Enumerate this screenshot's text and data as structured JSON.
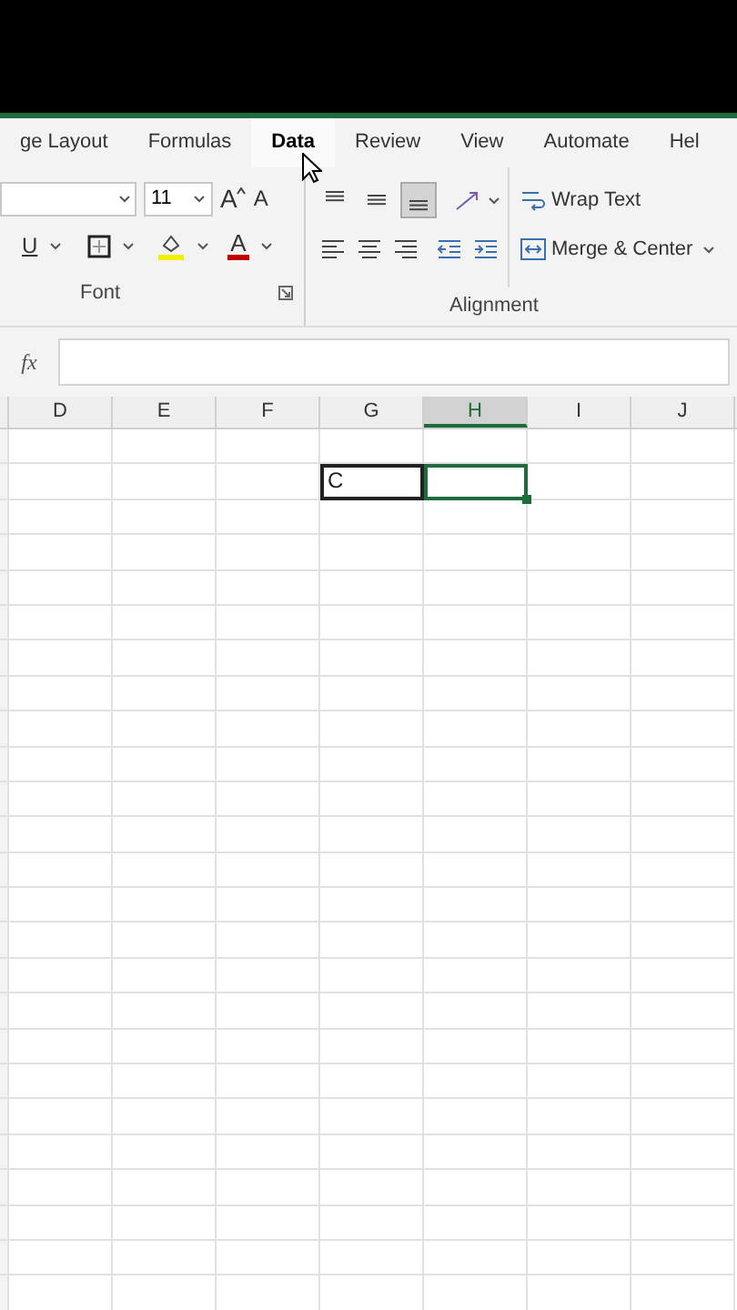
{
  "tabs": [
    {
      "label": "ge Layout",
      "hovered": false
    },
    {
      "label": "Formulas",
      "hovered": false
    },
    {
      "label": "Data",
      "hovered": true
    },
    {
      "label": "Review",
      "hovered": false
    },
    {
      "label": "View",
      "hovered": false
    },
    {
      "label": "Automate",
      "hovered": false
    },
    {
      "label": "Hel",
      "hovered": false
    }
  ],
  "ribbon": {
    "font": {
      "label": "Font",
      "size": "11",
      "grow": "A",
      "shrink": "A",
      "underline": "U",
      "color_letter": "A"
    },
    "alignment": {
      "label": "Alignment",
      "valign": [
        {
          "selected": false
        },
        {
          "selected": false
        },
        {
          "selected": true
        }
      ],
      "wrap_text": "Wrap Text",
      "merge_center": "Merge & Center"
    }
  },
  "formula_bar": {
    "fx": "fx"
  },
  "sheet": {
    "columns": [
      {
        "label": "D",
        "selected": false
      },
      {
        "label": "E",
        "selected": false
      },
      {
        "label": "F",
        "selected": false
      },
      {
        "label": "G",
        "selected": false
      },
      {
        "label": "H",
        "selected": true
      },
      {
        "label": "I",
        "selected": false
      },
      {
        "label": "J",
        "selected": false
      }
    ],
    "active_row": [
      {
        "bordered": false,
        "selected": false
      },
      {
        "bordered": false,
        "selected": false
      },
      {
        "bordered": false,
        "selected": false
      },
      {
        "text": "C",
        "bordered": true,
        "selected": false
      },
      {
        "bordered": false,
        "selected": true
      },
      {
        "bordered": false,
        "selected": false
      },
      {
        "bordered": false,
        "selected": false
      }
    ]
  }
}
